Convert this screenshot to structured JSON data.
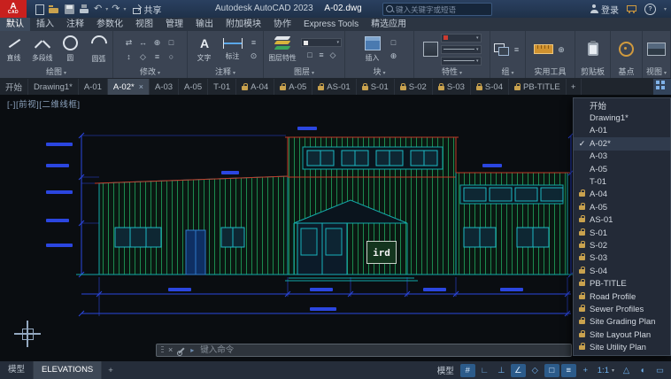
{
  "titlebar": {
    "logo_text": "A",
    "logo_sub": "CAD",
    "share_label": "共享",
    "app_title": "Autodesk AutoCAD 2023",
    "doc_title": "A-02.dwg",
    "search_placeholder": "键入关键字或短语",
    "login_label": "登录"
  },
  "icons": {
    "close": "×",
    "caret_down": "▾",
    "caret_right": "▸",
    "check": "✓",
    "undo": "↶",
    "redo": "↷",
    "help": "?",
    "text_tool": "A"
  },
  "menubar": {
    "tabs": [
      {
        "label": "默认",
        "active": true
      },
      {
        "label": "插入"
      },
      {
        "label": "注释"
      },
      {
        "label": "参数化"
      },
      {
        "label": "视图"
      },
      {
        "label": "管理"
      },
      {
        "label": "输出"
      },
      {
        "label": "附加模块"
      },
      {
        "label": "协作"
      },
      {
        "label": "Express Tools"
      },
      {
        "label": "精选应用"
      }
    ]
  },
  "ribbon": {
    "panels": {
      "draw": {
        "label": "绘图",
        "buttons": {
          "line": "直线",
          "polyline": "多段线",
          "circle": "圆",
          "arc": "圆弧"
        }
      },
      "modify": {
        "label": "修改",
        "glyphs": [
          "⇄",
          "↔",
          "⊕",
          "□",
          "↕",
          "◇",
          "≡",
          "○"
        ]
      },
      "annotate": {
        "label": "注释",
        "buttons": {
          "text": "文字",
          "dimension": "标注"
        },
        "glyphs": [
          "≡",
          "⊙"
        ]
      },
      "layers": {
        "label": "图层",
        "buttons": {
          "layer_props": "图层特性"
        },
        "glyphs": [
          "□",
          "≡",
          "◇"
        ]
      },
      "block": {
        "label": "块",
        "buttons": {
          "insert": "插入"
        },
        "glyphs": [
          "□",
          "⊕"
        ]
      },
      "properties": {
        "label": "特性"
      },
      "groups": {
        "label": "组",
        "glyphs": [
          "≡"
        ]
      },
      "utilities": {
        "label": "实用工具",
        "glyphs": [
          "⊕"
        ]
      },
      "clipboard": {
        "label": "剪贴板"
      },
      "basepoint": {
        "label": "基点"
      },
      "view": {
        "label": "视图"
      }
    }
  },
  "filetabs": {
    "tabs": [
      {
        "label": "开始"
      },
      {
        "label": "Drawing1*"
      },
      {
        "label": "A-01"
      },
      {
        "label": "A-02*",
        "active": true
      },
      {
        "label": "A-03"
      },
      {
        "label": "A-05"
      },
      {
        "label": "T-01"
      },
      {
        "label": "A-04",
        "locked": true
      },
      {
        "label": "A-05",
        "locked": true
      },
      {
        "label": "AS-01",
        "locked": true
      },
      {
        "label": "S-01",
        "locked": true
      },
      {
        "label": "S-02",
        "locked": true
      },
      {
        "label": "S-03",
        "locked": true
      },
      {
        "label": "S-04",
        "locked": true
      },
      {
        "label": "PB-TITLE",
        "locked": true
      }
    ],
    "new_tab": "+"
  },
  "tab_menu": {
    "items": [
      {
        "label": "开始"
      },
      {
        "label": "Drawing1*"
      },
      {
        "label": "A-01"
      },
      {
        "label": "A-02*",
        "checked": true
      },
      {
        "label": "A-03"
      },
      {
        "label": "A-05"
      },
      {
        "label": "T-01"
      },
      {
        "label": "A-04",
        "locked": true
      },
      {
        "label": "A-05",
        "locked": true
      },
      {
        "label": "AS-01",
        "locked": true
      },
      {
        "label": "S-01",
        "locked": true
      },
      {
        "label": "S-02",
        "locked": true
      },
      {
        "label": "S-03",
        "locked": true
      },
      {
        "label": "S-04",
        "locked": true
      },
      {
        "label": "PB-TITLE",
        "locked": true
      },
      {
        "label": "Road Profile",
        "locked": true
      },
      {
        "label": "Sewer Profiles",
        "locked": true
      },
      {
        "label": "Site Grading Plan",
        "locked": true
      },
      {
        "label": "Site Layout Plan",
        "locked": true
      },
      {
        "label": "Site Utility Plan",
        "locked": true
      }
    ]
  },
  "canvas": {
    "viewport_controls": "[-][前视][二维线框]",
    "door_sign": "ird"
  },
  "command_line": {
    "prompt_placeholder": "键入命令"
  },
  "statusbar": {
    "layout_tabs": [
      {
        "label": "模型"
      },
      {
        "label": "ELEVATIONS",
        "active": true
      }
    ],
    "new_layout": "+",
    "space_label": "模型",
    "scale_label": "1:1",
    "icons": [
      {
        "name": "grid",
        "glyph": "#",
        "on": true
      },
      {
        "name": "snap",
        "glyph": "∟"
      },
      {
        "name": "ortho",
        "glyph": "⊥"
      },
      {
        "name": "polar",
        "glyph": "∠",
        "on": true
      },
      {
        "name": "isodraft",
        "glyph": "◇"
      },
      {
        "name": "osnap",
        "glyph": "□",
        "on": true
      },
      {
        "name": "lineweight",
        "glyph": "≡",
        "on": true
      },
      {
        "name": "dynamic-input",
        "glyph": "+"
      }
    ],
    "icons_right": [
      {
        "name": "annotation-visibility",
        "glyph": "△"
      },
      {
        "name": "annotation-autoscale",
        "glyph": "◐"
      },
      {
        "name": "clean-screen",
        "glyph": "▭"
      }
    ]
  },
  "colors": {
    "accent_red": "#c8201e",
    "dim_blue": "#2b46e0",
    "line_teal": "#13a8a8",
    "siding_green": "#1c8a4e",
    "roof_red": "#c03a28"
  }
}
